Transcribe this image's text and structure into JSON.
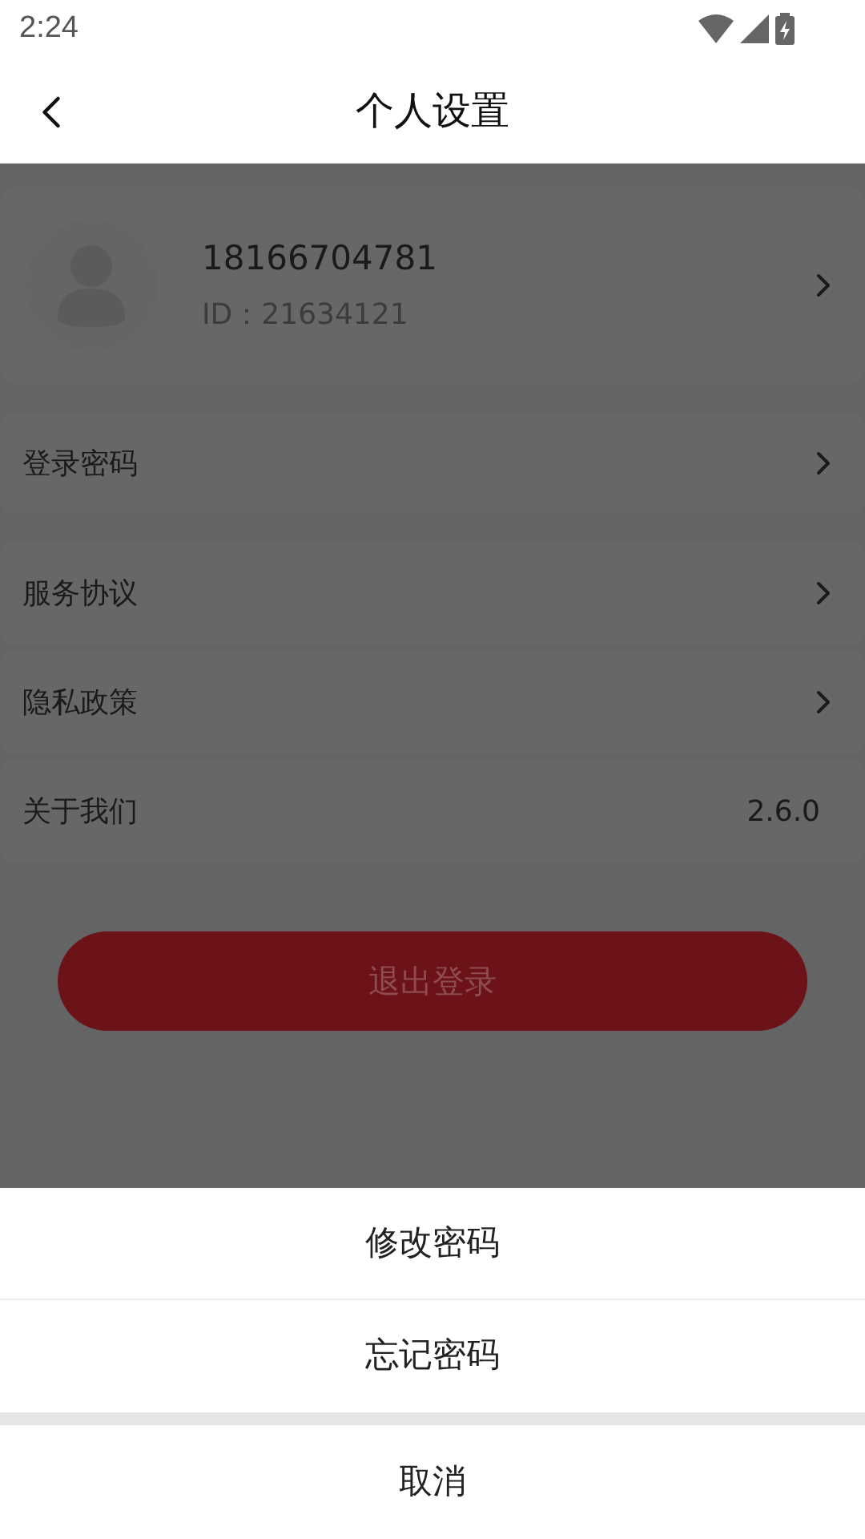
{
  "status_bar": {
    "time": "2:24"
  },
  "header": {
    "title": "个人设置"
  },
  "profile": {
    "phone": "18166704781",
    "id": "ID：21634121"
  },
  "menu": [
    {
      "label": "登录密码",
      "kind": "link"
    },
    {
      "label": "服务协议",
      "kind": "link"
    },
    {
      "label": "隐私政策",
      "kind": "link"
    },
    {
      "label": "关于我们",
      "kind": "value",
      "value": "2.6.0"
    }
  ],
  "logout_button": "退出登录",
  "action_sheet": {
    "options": [
      "修改密码",
      "忘记密码"
    ],
    "cancel": "取消"
  }
}
